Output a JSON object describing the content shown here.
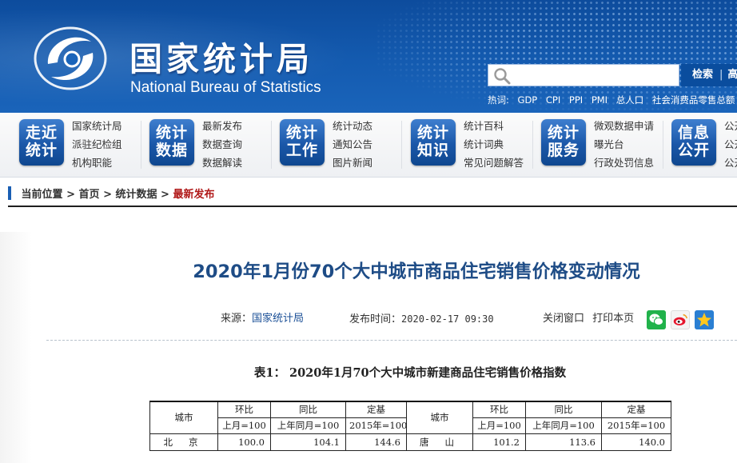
{
  "header": {
    "title_cn": "国家统计局",
    "title_en": "National Bureau of Statistics",
    "search": {
      "placeholder": "",
      "button_label": "检索",
      "button_extra": "高"
    },
    "hot": {
      "label": "热词:",
      "items": [
        "GDP",
        "CPI",
        "PPI",
        "PMI",
        "总人口",
        "社会消费品零售总额"
      ]
    }
  },
  "nav": {
    "groups": [
      {
        "badge": [
          "走近",
          "统计"
        ],
        "links": [
          "国家统计局",
          "派驻纪检组",
          "机构职能"
        ]
      },
      {
        "badge": [
          "统计",
          "数据"
        ],
        "links": [
          "最新发布",
          "数据查询",
          "数据解读"
        ]
      },
      {
        "badge": [
          "统计",
          "工作"
        ],
        "links": [
          "统计动态",
          "通知公告",
          "图片新闻"
        ]
      },
      {
        "badge": [
          "统计",
          "知识"
        ],
        "links": [
          "统计百科",
          "统计词典",
          "常见问题解答"
        ]
      },
      {
        "badge": [
          "统计",
          "服务"
        ],
        "links": [
          "微观数据申请",
          "曝光台",
          "行政处罚信息"
        ]
      },
      {
        "badge": [
          "信息",
          "公开"
        ],
        "links": [
          "公开",
          "公开",
          "公开"
        ]
      }
    ]
  },
  "breadcrumb": {
    "items": [
      "当前位置",
      "首页",
      "统计数据",
      "最新发布"
    ],
    "separator": ">"
  },
  "article": {
    "title": "2020年1月份70个大中城市商品住宅销售价格变动情况",
    "source_label": "来源：",
    "source": "国家统计局",
    "time_label": "发布时间：",
    "time": "2020-02-17 09:30",
    "close_label": "关闭窗口",
    "print_label": "打印本页"
  },
  "table": {
    "caption": "表1：  2020年1月70个大中城市新建商品住宅销售价格指数",
    "header_city": "城市",
    "header_groups": [
      "环比",
      "同比",
      "定基"
    ],
    "header_bases": [
      "上月=100",
      "上年同月=100",
      "2015年=100"
    ],
    "rows": [
      {
        "left": {
          "city": "北京",
          "mom": "100.0",
          "yoy": "104.1",
          "base": "144.6"
        },
        "right": {
          "city": "唐山",
          "mom": "101.2",
          "yoy": "113.6",
          "base": "140.0"
        }
      }
    ]
  },
  "colors": {
    "header_blue": "#145bb0",
    "title_blue": "#1e4c86",
    "breadcrumb_current": "#b01818"
  }
}
